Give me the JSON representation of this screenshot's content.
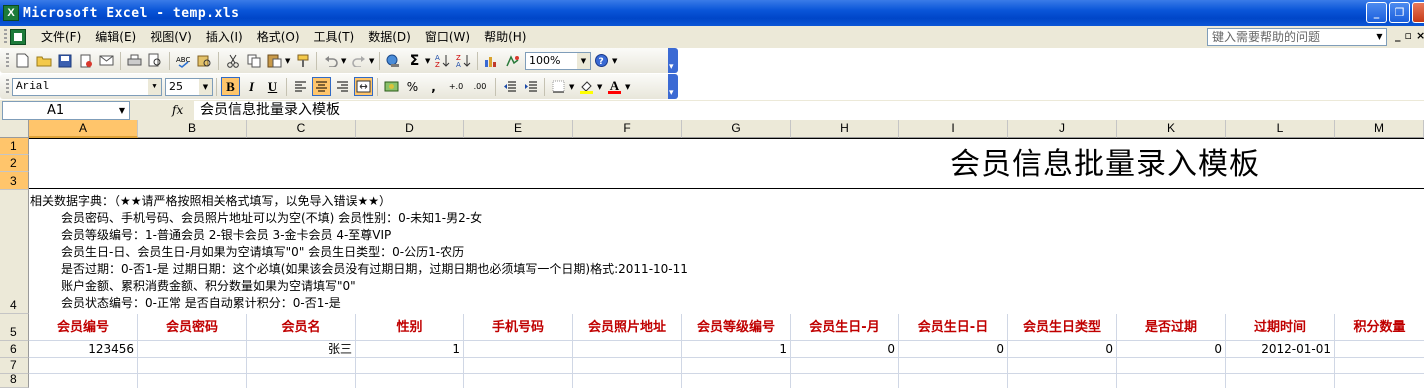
{
  "window": {
    "title": "Microsoft Excel - temp.xls",
    "app_icon_letter": "X",
    "minimize": "_",
    "restore": "❐",
    "close": "×"
  },
  "menu": {
    "items": [
      "文件(F)",
      "编辑(E)",
      "视图(V)",
      "插入(I)",
      "格式(O)",
      "工具(T)",
      "数据(D)",
      "窗口(W)",
      "帮助(H)"
    ],
    "help_placeholder": "键入需要帮助的问题",
    "doc_min": "_",
    "doc_restore": "▫",
    "doc_close": "×"
  },
  "standard_toolbar": {
    "zoom": "100%"
  },
  "formatting_toolbar": {
    "font": "Arial",
    "size": "25",
    "bold": "B",
    "italic": "I",
    "underline": "U",
    "percent": "%",
    "comma": ",",
    "inc_decimal": "+.0",
    "dec_decimal": ".00",
    "font_color_letter": "A"
  },
  "formula_bar": {
    "cell_ref": "A1",
    "fx": "fx",
    "content": "会员信息批量录入模板"
  },
  "columns": [
    "A",
    "B",
    "C",
    "D",
    "E",
    "F",
    "G",
    "H",
    "I",
    "J",
    "K",
    "L",
    "M"
  ],
  "rows": [
    "1",
    "2",
    "3",
    "4",
    "5",
    "6",
    "7",
    "8"
  ],
  "sheet": {
    "title": "会员信息批量录入模板",
    "notes": [
      "相关数据字典：（★★请严格按照相关格式填写，以免导入错误★★）",
      "会员密码、手机号码、会员照片地址可以为空(不填)  会员性别：0-未知1-男2-女",
      "会员等级编号：1-普通会员  2-银卡会员  3-金卡会员  4-至尊VIP",
      "会员生日-日、会员生日-月如果为空请填写\"0\"  会员生日类型：0-公历1-农历",
      "是否过期：0-否1-是   过期日期：这个必填(如果该会员没有过期日期，过期日期也必须填写一个日期)格式:2011-10-11",
      "账户金额、累积消费金额、积分数量如果为空请填写\"0\"",
      "会员状态编号：0-正常  是否自动累计积分：0-否1-是"
    ],
    "headers": [
      "会员编号",
      "会员密码",
      "会员名",
      "性别",
      "手机号码",
      "会员照片地址",
      "会员等级编号",
      "会员生日-月",
      "会员生日-日",
      "会员生日类型",
      "是否过期",
      "过期时间",
      "积分数量"
    ],
    "row6": [
      "123456",
      "",
      "张三",
      "1",
      "",
      "",
      "1",
      "0",
      "0",
      "0",
      "0",
      "2012-01-01",
      ""
    ]
  }
}
